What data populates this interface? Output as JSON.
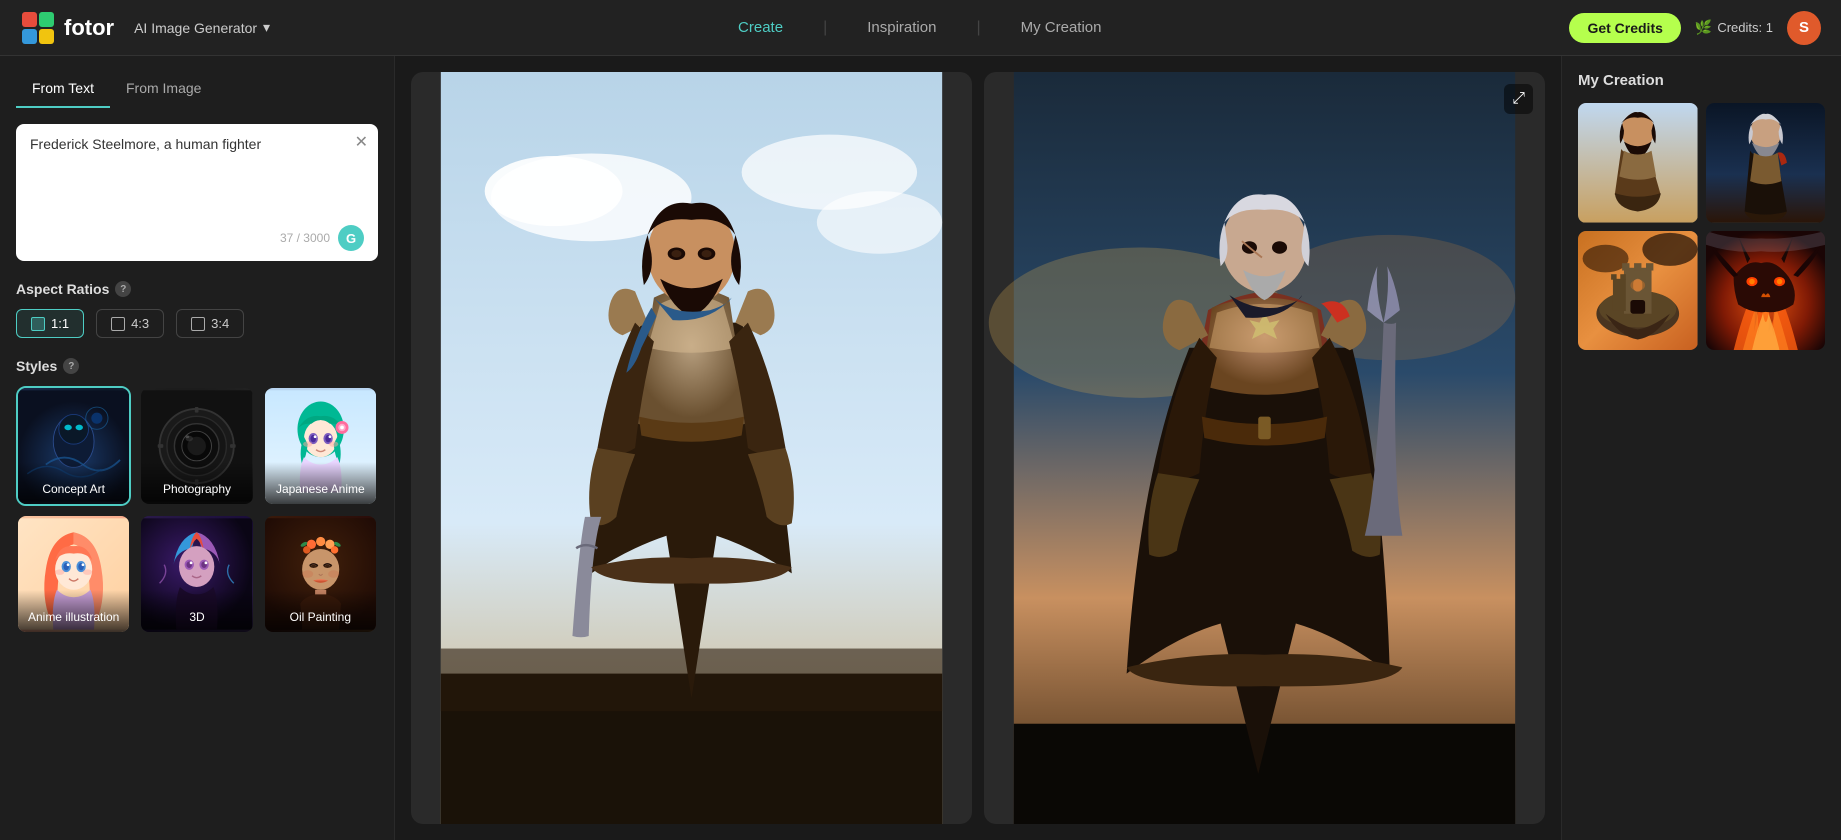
{
  "app": {
    "name": "fotor",
    "logo_emoji": "🟥🟩🟦🟨"
  },
  "header": {
    "ai_generator_label": "AI Image Generator",
    "dropdown_icon": "▾",
    "nav": [
      {
        "label": "Create",
        "active": true
      },
      {
        "label": "Inspiration",
        "active": false
      },
      {
        "label": "My Creation",
        "active": false
      }
    ],
    "get_credits_label": "Get Credits",
    "credits_label": "Credits: 1",
    "avatar_initial": "S"
  },
  "left_panel": {
    "tabs": [
      {
        "label": "From Text",
        "active": true
      },
      {
        "label": "From Image",
        "active": false
      }
    ],
    "textarea_value": "Frederick Steelmore, a human fighter",
    "char_count": "37 / 3000",
    "aspect_ratios_label": "Aspect Ratios",
    "ratios": [
      {
        "label": "1:1",
        "active": true
      },
      {
        "label": "4:3",
        "active": false
      },
      {
        "label": "3:4",
        "active": false
      }
    ],
    "styles_label": "Styles",
    "styles": [
      {
        "label": "Concept Art",
        "active": true,
        "key": "concept-art"
      },
      {
        "label": "Photography",
        "active": false,
        "key": "photography"
      },
      {
        "label": "Japanese Anime",
        "active": false,
        "key": "japanese-anime"
      },
      {
        "label": "Anime illustration",
        "active": false,
        "key": "anime-illustration"
      },
      {
        "label": "3D",
        "active": false,
        "key": "3d"
      },
      {
        "label": "Oil Painting",
        "active": false,
        "key": "oil-painting"
      }
    ]
  },
  "main": {
    "images": [
      {
        "alt": "Fighter character 1"
      },
      {
        "alt": "Fighter character 2"
      }
    ],
    "expand_icon": "⤢"
  },
  "right_panel": {
    "title": "My Creation",
    "images": [
      {
        "alt": "Creation 1 - fighter"
      },
      {
        "alt": "Creation 2 - fighter dark"
      },
      {
        "alt": "Creation 3 - castle"
      },
      {
        "alt": "Creation 4 - dragon"
      }
    ]
  }
}
